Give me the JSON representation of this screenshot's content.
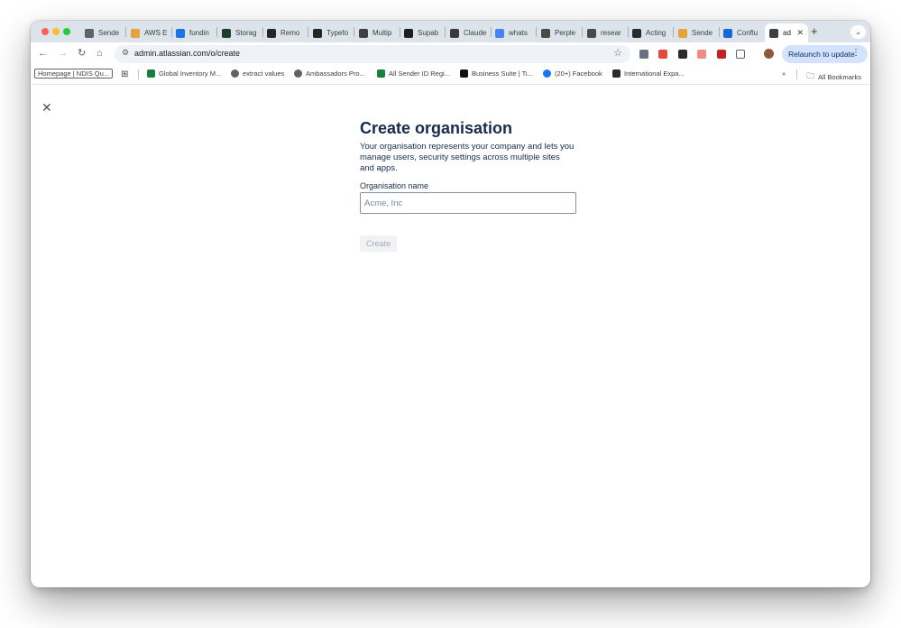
{
  "browser": {
    "tabs": [
      {
        "title": "Sende",
        "icon": "globe-icon",
        "color": "#5f6368"
      },
      {
        "title": "AWS E",
        "icon": "aws-icon",
        "color": "#e8a23a"
      },
      {
        "title": "fundin",
        "icon": "google-drive-icon",
        "color": "#1a73e8"
      },
      {
        "title": "Storag",
        "icon": "storage-icon",
        "color": "#1f3d2b"
      },
      {
        "title": "Remo",
        "icon": "typeform-icon",
        "color": "#262626"
      },
      {
        "title": "Typefo",
        "icon": "typeform-icon",
        "color": "#262626"
      },
      {
        "title": "Multip",
        "icon": "multiplayer-icon",
        "color": "#404040"
      },
      {
        "title": "Supab",
        "icon": "supabase-icon",
        "color": "#1f1f1f"
      },
      {
        "title": "Claude",
        "icon": "claude-icon",
        "color": "#3a3a3a"
      },
      {
        "title": "whats",
        "icon": "google-icon",
        "color": "#4285f4"
      },
      {
        "title": "Perple",
        "icon": "perplexity-icon",
        "color": "#4a4a4a"
      },
      {
        "title": "resear",
        "icon": "openai-icon",
        "color": "#4a4a4a"
      },
      {
        "title": "Acting",
        "icon": "notion-icon",
        "color": "#2b2b2b"
      },
      {
        "title": "Sende",
        "icon": "aws-icon",
        "color": "#e8a23a"
      },
      {
        "title": "Conflu",
        "icon": "confluence-icon",
        "color": "#1868db"
      },
      {
        "title": "ad",
        "icon": "gear-icon",
        "color": "#3c4043",
        "active": true
      }
    ],
    "url": "admin.atlassian.com/o/create",
    "relaunch_label": "Relaunch to update",
    "new_tab_symbol": "+",
    "bookmarks": [
      {
        "label": "Homepage | NDIS Qu...",
        "icon": "",
        "boxed": true
      },
      {
        "label": "Global Inventory M...",
        "icon": "sheets-icon",
        "color": "#188038"
      },
      {
        "label": "extract values",
        "icon": "globe-icon",
        "color": "#5f6368"
      },
      {
        "label": "Ambassadors Pro...",
        "icon": "globe-icon",
        "color": "#5f6368"
      },
      {
        "label": "All Sender ID Regi...",
        "icon": "sheets-icon",
        "color": "#188038"
      },
      {
        "label": "Business Suite | Ti...",
        "icon": "tiktok-icon",
        "color": "#111111"
      },
      {
        "label": "(20+) Facebook",
        "icon": "facebook-icon",
        "color": "#1877f2"
      },
      {
        "label": "International Expa...",
        "icon": "pencil-icon",
        "color": "#2b2b2b"
      }
    ],
    "all_bookmarks_label": "All Bookmarks",
    "overflow_symbol": "»"
  },
  "page": {
    "title": "Create organisation",
    "description": "Your organisation represents your company and lets you manage users, security settings across multiple sites and apps.",
    "field_label": "Organisation name",
    "field_placeholder": "Acme, Inc",
    "field_value": "",
    "create_label": "Create",
    "create_disabled": true
  }
}
